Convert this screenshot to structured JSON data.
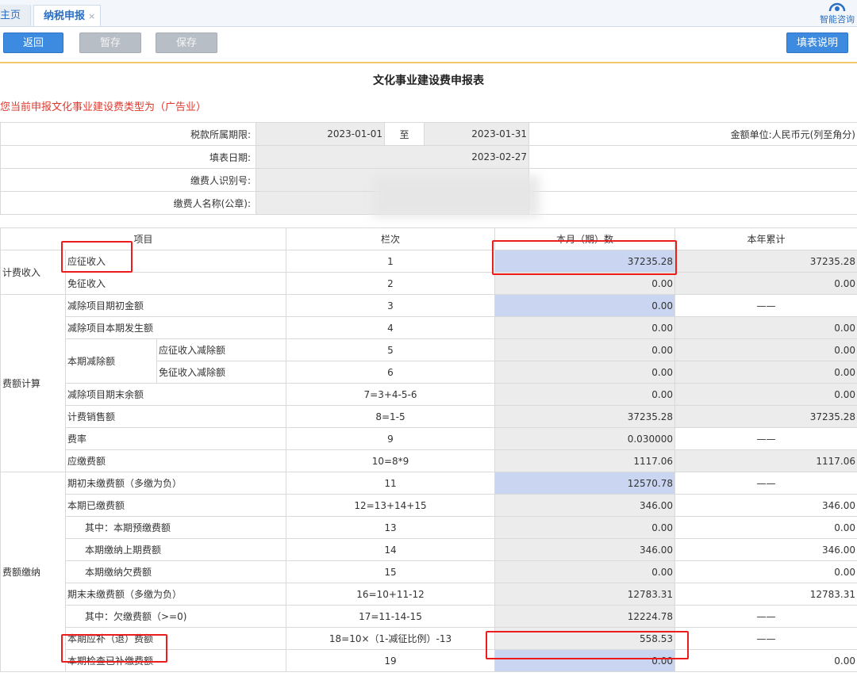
{
  "tabs": {
    "home": "主页",
    "active": "纳税申报",
    "close": "×"
  },
  "assistant": {
    "label": "智能咨询",
    "icon": "headset-icon"
  },
  "toolbar": {
    "back": "返回",
    "temp_save": "暂存",
    "save": "保存",
    "help": "填表说明"
  },
  "title": "文化事业建设费申报表",
  "notice": "您当前申报文化事业建设费类型为（广告业）",
  "info": {
    "period_label": "税款所属期限:",
    "period_from": "2023-01-01",
    "period_to_label": "至",
    "period_to": "2023-01-31",
    "unit": "金额单位:人民币元(列至角分)",
    "fill_date_label": "填表日期:",
    "fill_date": "2023-02-27",
    "taxpayer_id_label": "缴费人识别号:",
    "taxpayer_id": "",
    "taxpayer_name_label": "缴费人名称(公章):",
    "taxpayer_name": ""
  },
  "table": {
    "headers": {
      "item": "项目",
      "column": "栏次",
      "current": "本月（期）数",
      "ytd": "本年累计"
    },
    "groups": {
      "income": "计费收入",
      "calc": "费额计算",
      "payment": "费额缴纳",
      "deduction_parent": "本期减除额"
    },
    "rows": [
      {
        "name": "应征收入",
        "col": "1",
        "current": "37235.28",
        "ytd": "37235.28"
      },
      {
        "name": "免征收入",
        "col": "2",
        "current": "0.00",
        "ytd": "0.00"
      },
      {
        "name": "减除项目期初金额",
        "col": "3",
        "current": "0.00",
        "ytd": "——"
      },
      {
        "name": "减除项目本期发生额",
        "col": "4",
        "current": "0.00",
        "ytd": "0.00"
      },
      {
        "name": "应征收入减除额",
        "col": "5",
        "current": "0.00",
        "ytd": "0.00"
      },
      {
        "name": "免征收入减除额",
        "col": "6",
        "current": "0.00",
        "ytd": "0.00"
      },
      {
        "name": "减除项目期末余额",
        "col": "7=3+4-5-6",
        "current": "0.00",
        "ytd": "0.00"
      },
      {
        "name": "计费销售额",
        "col": "8=1-5",
        "current": "37235.28",
        "ytd": "37235.28"
      },
      {
        "name": "费率",
        "col": "9",
        "current": "0.030000",
        "ytd": "——"
      },
      {
        "name": "应缴费额",
        "col": "10=8*9",
        "current": "1117.06",
        "ytd": "1117.06"
      },
      {
        "name": "期初未缴费额（多缴为负）",
        "col": "11",
        "current": "12570.78",
        "ytd": "——"
      },
      {
        "name": "本期已缴费额",
        "col": "12=13+14+15",
        "current": "346.00",
        "ytd": "346.00"
      },
      {
        "name": "其中：本期预缴费额",
        "col": "13",
        "current": "0.00",
        "ytd": "0.00"
      },
      {
        "name": "本期缴纳上期费额",
        "col": "14",
        "current": "346.00",
        "ytd": "346.00"
      },
      {
        "name": "本期缴纳欠费额",
        "col": "15",
        "current": "0.00",
        "ytd": "0.00"
      },
      {
        "name": "期末未缴费额（多缴为负）",
        "col": "16=10+11-12",
        "current": "12783.31",
        "ytd": "12783.31"
      },
      {
        "name": "其中：欠缴费额（>=0)",
        "col": "17=11-14-15",
        "current": "12224.78",
        "ytd": "——"
      },
      {
        "name": "本期应补（退）费额",
        "col": "18=10×（1-减征比例）-13",
        "current": "558.53",
        "ytd": "——"
      },
      {
        "name": "本期检查已补缴费额",
        "col": "19",
        "current": "0.00",
        "ytd": "0.00"
      }
    ]
  },
  "colors": {
    "accent": "#3d8be0",
    "highlight": "#c9d5f1",
    "annotation": "#ee1d1d",
    "notice": "#e03a2f"
  }
}
